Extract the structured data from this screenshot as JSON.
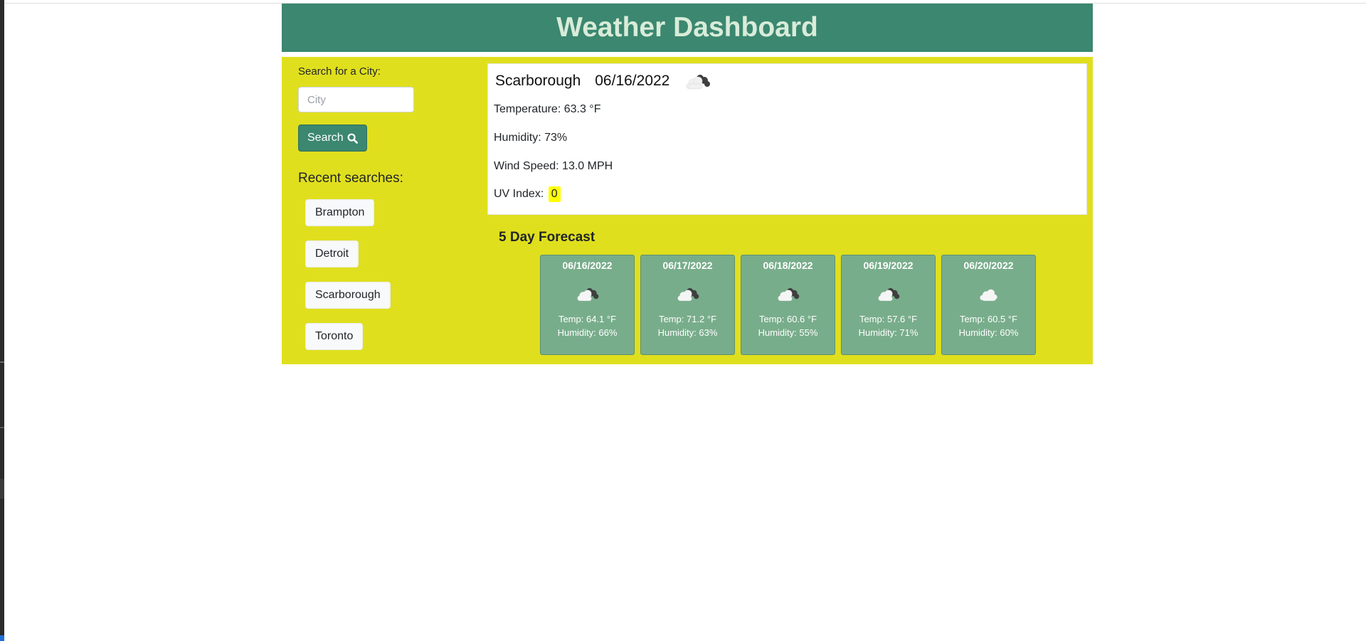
{
  "header": {
    "title": "Weather Dashboard"
  },
  "search": {
    "label": "Search for a City:",
    "placeholder": "City",
    "button_label": "Search",
    "button_icon": "search-icon"
  },
  "recent": {
    "title": "Recent searches:",
    "items": [
      "Brampton",
      "Detroit",
      "Scarborough",
      "Toronto"
    ]
  },
  "current": {
    "city": "Scarborough",
    "date": "06/16/2022",
    "icon": "broken-clouds-icon",
    "temperature": "Temperature: 63.3 °F",
    "humidity": "Humidity: 73%",
    "wind": "Wind Speed: 13.0 MPH",
    "uv_label": "UV Index:",
    "uv_value": "0",
    "uv_color": "#ffff00"
  },
  "forecast": {
    "title": "5 Day Forecast",
    "days": [
      {
        "date": "06/16/2022",
        "icon": "broken-clouds-icon",
        "temp": "Temp: 64.1 °F",
        "humidity": "Humidity: 66%"
      },
      {
        "date": "06/17/2022",
        "icon": "broken-clouds-icon",
        "temp": "Temp: 71.2 °F",
        "humidity": "Humidity: 63%"
      },
      {
        "date": "06/18/2022",
        "icon": "broken-clouds-icon",
        "temp": "Temp: 60.6 °F",
        "humidity": "Humidity: 55%"
      },
      {
        "date": "06/19/2022",
        "icon": "broken-clouds-icon",
        "temp": "Temp: 57.6 °F",
        "humidity": "Humidity: 71%"
      },
      {
        "date": "06/20/2022",
        "icon": "cloud-icon",
        "temp": "Temp: 60.5 °F",
        "humidity": "Humidity: 60%"
      }
    ]
  },
  "colors": {
    "header_bg": "#3b8770",
    "main_bg": "#e0df1e",
    "card_bg": "#78ad8b"
  }
}
